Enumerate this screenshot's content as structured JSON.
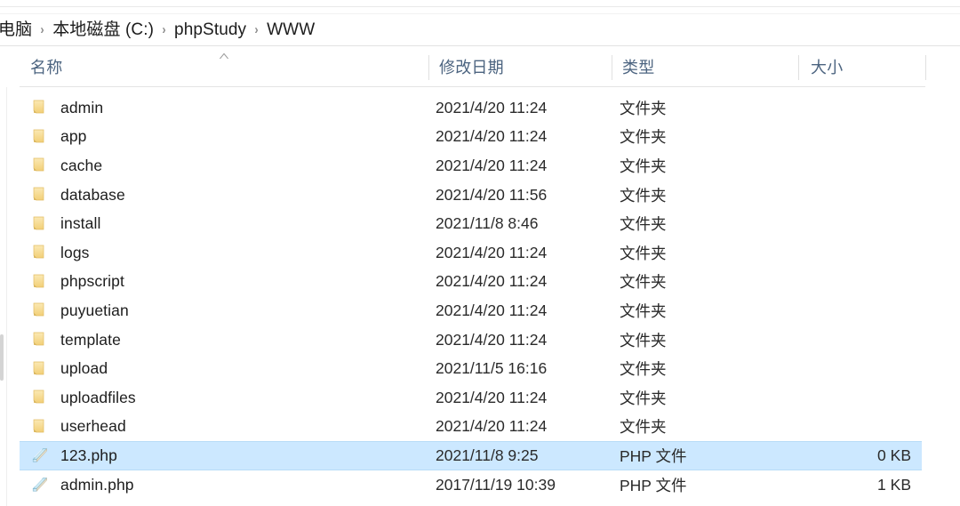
{
  "window": {
    "app": "Windows File Explorer",
    "current_folder": "WWW"
  },
  "breadcrumb": {
    "separator": "›",
    "items": [
      {
        "label": "电脑"
      },
      {
        "label": "本地磁盘 (C:)"
      },
      {
        "label": "phpStudy"
      },
      {
        "label": "WWW"
      }
    ]
  },
  "columns": {
    "name": "名称",
    "date_modified": "修改日期",
    "type": "类型",
    "size": "大小",
    "sort_column": "名称",
    "sort_direction": "ascending"
  },
  "colors": {
    "selection": "#cce8ff",
    "selection_border": "#b8dcf7",
    "header_text": "#4c6480",
    "folder_icon": "#f6d98b",
    "php_icon": "#a8d9ea"
  },
  "rows": [
    {
      "icon": "folder-icon",
      "name": "admin",
      "date": "2021/4/20 11:24",
      "type": "文件夹",
      "size": "",
      "selected": false
    },
    {
      "icon": "folder-icon",
      "name": "app",
      "date": "2021/4/20 11:24",
      "type": "文件夹",
      "size": "",
      "selected": false
    },
    {
      "icon": "folder-icon",
      "name": "cache",
      "date": "2021/4/20 11:24",
      "type": "文件夹",
      "size": "",
      "selected": false
    },
    {
      "icon": "folder-icon",
      "name": "database",
      "date": "2021/4/20 11:56",
      "type": "文件夹",
      "size": "",
      "selected": false
    },
    {
      "icon": "folder-icon",
      "name": "install",
      "date": "2021/11/8 8:46",
      "type": "文件夹",
      "size": "",
      "selected": false
    },
    {
      "icon": "folder-icon",
      "name": "logs",
      "date": "2021/4/20 11:24",
      "type": "文件夹",
      "size": "",
      "selected": false
    },
    {
      "icon": "folder-icon",
      "name": "phpscript",
      "date": "2021/4/20 11:24",
      "type": "文件夹",
      "size": "",
      "selected": false
    },
    {
      "icon": "folder-icon",
      "name": "puyuetian",
      "date": "2021/4/20 11:24",
      "type": "文件夹",
      "size": "",
      "selected": false
    },
    {
      "icon": "folder-icon",
      "name": "template",
      "date": "2021/4/20 11:24",
      "type": "文件夹",
      "size": "",
      "selected": false
    },
    {
      "icon": "folder-icon",
      "name": "upload",
      "date": "2021/11/5 16:16",
      "type": "文件夹",
      "size": "",
      "selected": false
    },
    {
      "icon": "folder-icon",
      "name": "uploadfiles",
      "date": "2021/4/20 11:24",
      "type": "文件夹",
      "size": "",
      "selected": false
    },
    {
      "icon": "folder-icon",
      "name": "userhead",
      "date": "2021/4/20 11:24",
      "type": "文件夹",
      "size": "",
      "selected": false
    },
    {
      "icon": "php-file-icon",
      "name": "123.php",
      "date": "2021/11/8 9:25",
      "type": "PHP 文件",
      "size": "0 KB",
      "selected": true
    },
    {
      "icon": "php-file-icon",
      "name": "admin.php",
      "date": "2017/11/19 10:39",
      "type": "PHP 文件",
      "size": "1 KB",
      "selected": false
    }
  ]
}
